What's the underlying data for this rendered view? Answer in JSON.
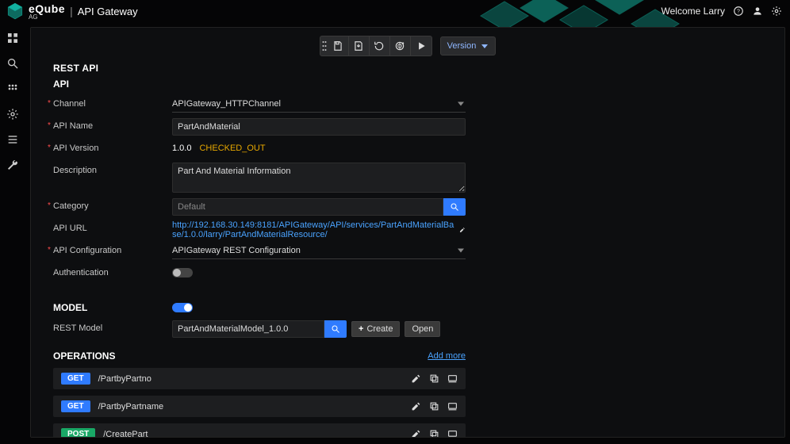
{
  "app": {
    "brand": "eQube",
    "brand_sub": "AG",
    "separator": "|",
    "title": "API Gateway"
  },
  "header": {
    "welcome_prefix": "Welcome",
    "username": "Larry",
    "icons": [
      "help-icon",
      "user-icon",
      "settings-icon"
    ]
  },
  "leftnav": {
    "items": [
      {
        "name": "dashboard-icon"
      },
      {
        "name": "search-icon"
      },
      {
        "name": "apps-icon"
      },
      {
        "name": "gear-icon"
      },
      {
        "name": "list-icon"
      },
      {
        "name": "wrench-icon"
      }
    ]
  },
  "toolbar": {
    "buttons": [
      {
        "name": "drag-handle-icon"
      },
      {
        "name": "save-icon"
      },
      {
        "name": "export-icon"
      },
      {
        "name": "revert-icon"
      },
      {
        "name": "publish-icon"
      },
      {
        "name": "play-icon"
      }
    ],
    "version_label": "Version"
  },
  "page": {
    "title": "REST API",
    "sections": {
      "api": {
        "heading": "API",
        "channel_label": "Channel",
        "channel_value": "APIGateway_HTTPChannel",
        "name_label": "API Name",
        "name_value": "PartAndMaterial",
        "version_label": "API Version",
        "version_value": "1.0.0",
        "version_status": "CHECKED_OUT",
        "description_label": "Description",
        "description_value": "Part And Material Information",
        "category_label": "Category",
        "category_placeholder": "Default",
        "url_label": "API URL",
        "url_value": "http://192.168.30.149:8181/APIGateway/API/services/PartAndMaterialBase/1.0.0/larry/PartAndMaterialResource/",
        "config_label": "API Configuration",
        "config_value": "APIGateway REST Configuration",
        "auth_label": "Authentication",
        "auth_on": false
      },
      "model": {
        "heading": "MODEL",
        "toggle_on": true,
        "rest_model_label": "REST Model",
        "rest_model_value": "PartAndMaterialModel_1.0.0",
        "create_btn": "Create",
        "open_btn": "Open"
      },
      "operations": {
        "heading": "OPERATIONS",
        "add_more": "Add more",
        "rows": [
          {
            "method": "GET",
            "method_class": "get",
            "path": "/PartbyPartno"
          },
          {
            "method": "GET",
            "method_class": "get",
            "path": "/PartbyPartname"
          },
          {
            "method": "POST",
            "method_class": "post",
            "path": "/CreatePart"
          }
        ]
      }
    }
  },
  "colors": {
    "accent": "#2f7bff",
    "link": "#4aa3ff",
    "green_method": "#19a866",
    "status_orange": "#e6a700"
  }
}
